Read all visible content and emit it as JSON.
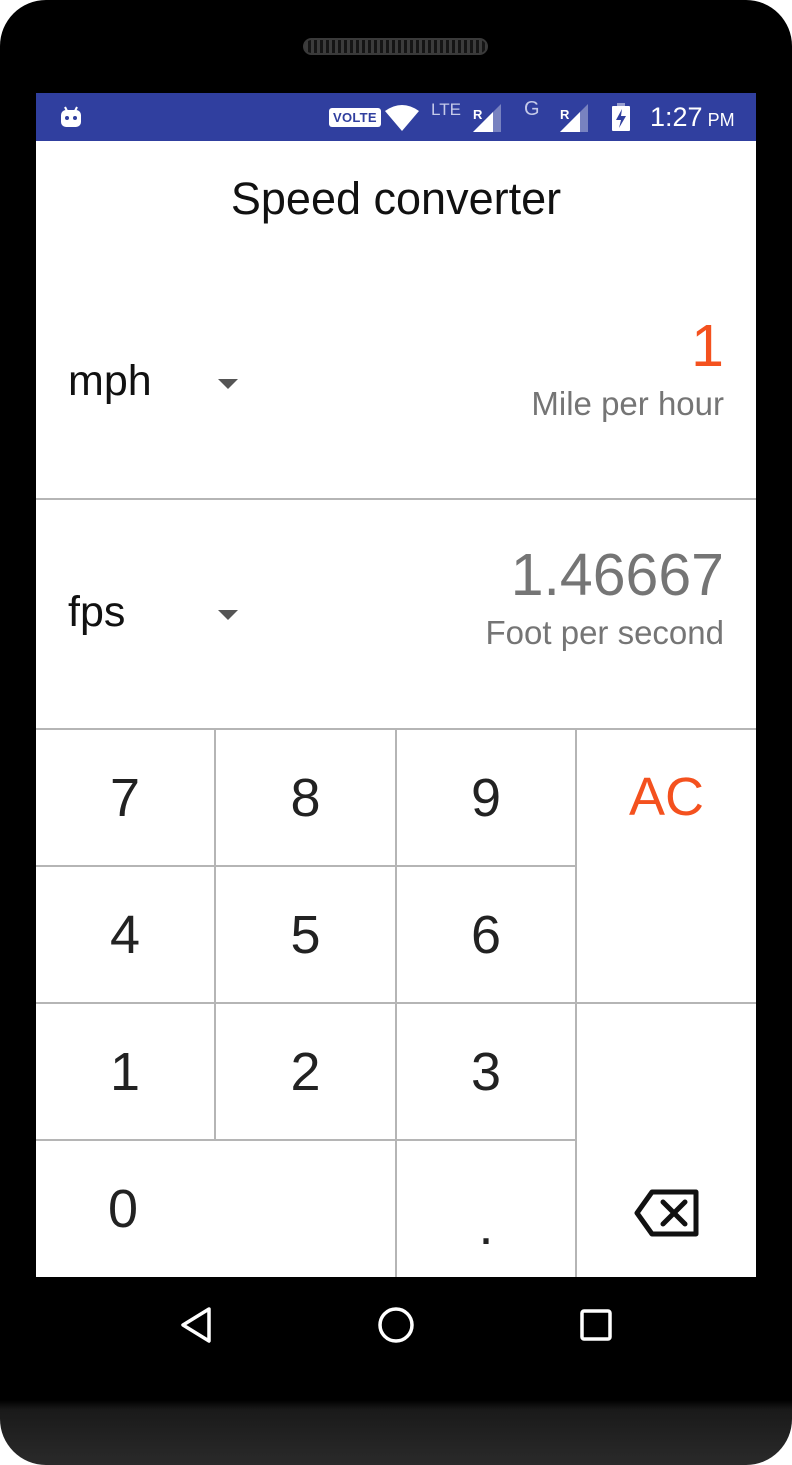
{
  "status_bar": {
    "volte": "VOLTE",
    "lte": "LTE",
    "roaming_1": "R",
    "network_2": "G",
    "roaming_2": "R",
    "time": "1:27",
    "ampm": "PM",
    "color": "#303f9f"
  },
  "app": {
    "title": "Speed converter"
  },
  "from_unit": {
    "code": "mph",
    "value": "1",
    "name": "Mile per hour"
  },
  "to_unit": {
    "code": "fps",
    "value": "1.46667",
    "name": "Foot per second"
  },
  "keypad": {
    "k7": "7",
    "k8": "8",
    "k9": "9",
    "clear": "AC",
    "k4": "4",
    "k5": "5",
    "k6": "6",
    "k1": "1",
    "k2": "2",
    "k3": "3",
    "k0": "0",
    "dot": ".",
    "backspace_icon": "backspace-icon"
  },
  "accent_color": "#f4511e"
}
